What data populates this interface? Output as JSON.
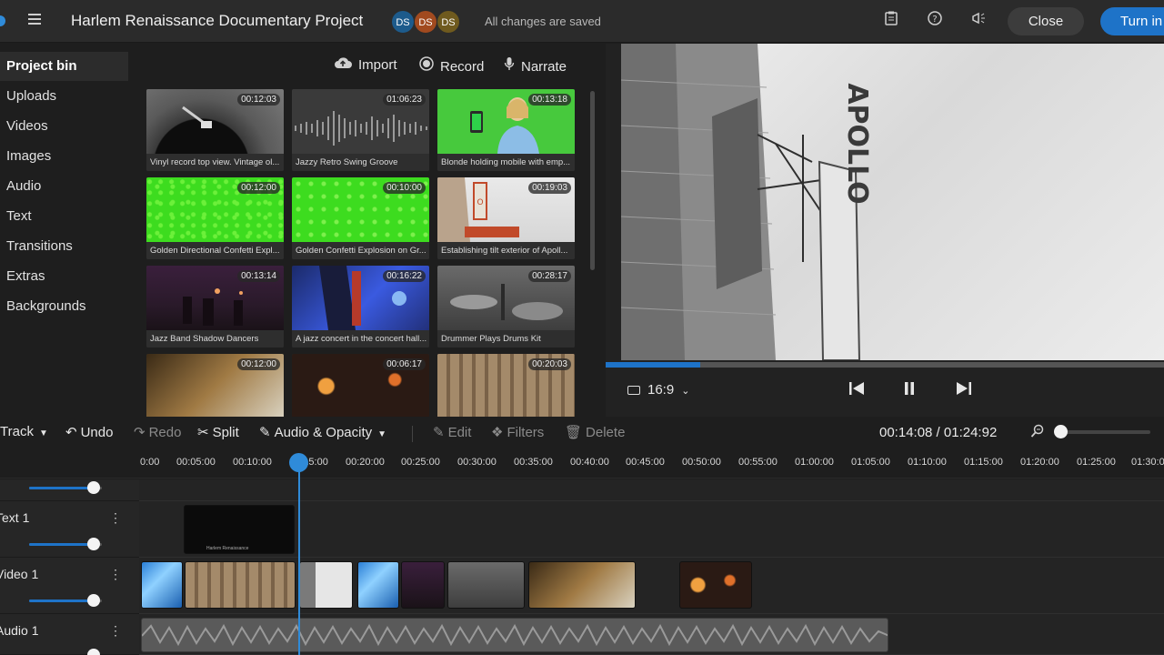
{
  "header": {
    "title": "Harlem Renaissance Documentary Project",
    "avatars": [
      {
        "initials": "DS",
        "color": "#1d5b8c"
      },
      {
        "initials": "DS",
        "color": "#a14a1f"
      },
      {
        "initials": "DS",
        "color": "#6f5a1e"
      }
    ],
    "save_status": "All changes are saved",
    "close_label": "Close",
    "turn_in_label": "Turn in"
  },
  "sidebar": {
    "items": [
      {
        "label": "Project bin",
        "active": true
      },
      {
        "label": "Uploads"
      },
      {
        "label": "Videos"
      },
      {
        "label": "Images"
      },
      {
        "label": "Audio"
      },
      {
        "label": "Text"
      },
      {
        "label": "Transitions"
      },
      {
        "label": "Extras"
      },
      {
        "label": "Backgrounds"
      }
    ]
  },
  "bin": {
    "import_label": "Import",
    "record_label": "Record",
    "narrate_label": "Narrate",
    "items": [
      {
        "duration": "00:12:03",
        "caption": "Vinyl record top view. Vintage ol..."
      },
      {
        "duration": "01:06:23",
        "caption": "Jazzy Retro Swing Groove"
      },
      {
        "duration": "00:13:18",
        "caption": "Blonde holding mobile with emp..."
      },
      {
        "duration": "00:12:00",
        "caption": "Golden Directional Confetti Expl..."
      },
      {
        "duration": "00:10:00",
        "caption": "Golden Confetti Explosion on Gr..."
      },
      {
        "duration": "00:19:03",
        "caption": "Establishing tilt exterior of Apoll..."
      },
      {
        "duration": "00:13:14",
        "caption": "Jazz Band Shadow Dancers"
      },
      {
        "duration": "00:16:22",
        "caption": "A jazz concert in the concert hall..."
      },
      {
        "duration": "00:28:17",
        "caption": "Drummer Plays Drums Kit"
      },
      {
        "duration": "00:12:00",
        "caption": ""
      },
      {
        "duration": "00:06:17",
        "caption": ""
      },
      {
        "duration": "00:20:03",
        "caption": ""
      }
    ]
  },
  "preview": {
    "sign_text": "APOLLO",
    "progress_percent": 17,
    "aspect_ratio": "16:9"
  },
  "timeline_toolbar": {
    "track_label": "Track",
    "undo_label": "Undo",
    "redo_label": "Redo",
    "split_label": "Split",
    "audio_opacity_label": "Audio & Opacity",
    "edit_label": "Edit",
    "filters_label": "Filters",
    "delete_label": "Delete",
    "time_display": "00:14:08 / 01:24:92"
  },
  "ruler": {
    "ticks": [
      "0:00",
      "00:05:00",
      "00:10:00",
      "00:15:00",
      "00:20:00",
      "00:25:00",
      "00:30:00",
      "00:35:00",
      "00:40:00",
      "00:45:00",
      "00:50:00",
      "00:55:00",
      "01:00:00",
      "01:05:00",
      "01:10:00",
      "01:15:00",
      "01:20:00",
      "01:25:00",
      "01:30:00"
    ]
  },
  "tracks": [
    {
      "label": "",
      "type": "top"
    },
    {
      "label": "Text 1",
      "type": "text"
    },
    {
      "label": "Video 1",
      "type": "video"
    },
    {
      "label": "Audio 1",
      "type": "audio"
    }
  ],
  "text_clip": {
    "caption": "Harlem Renaissance"
  }
}
